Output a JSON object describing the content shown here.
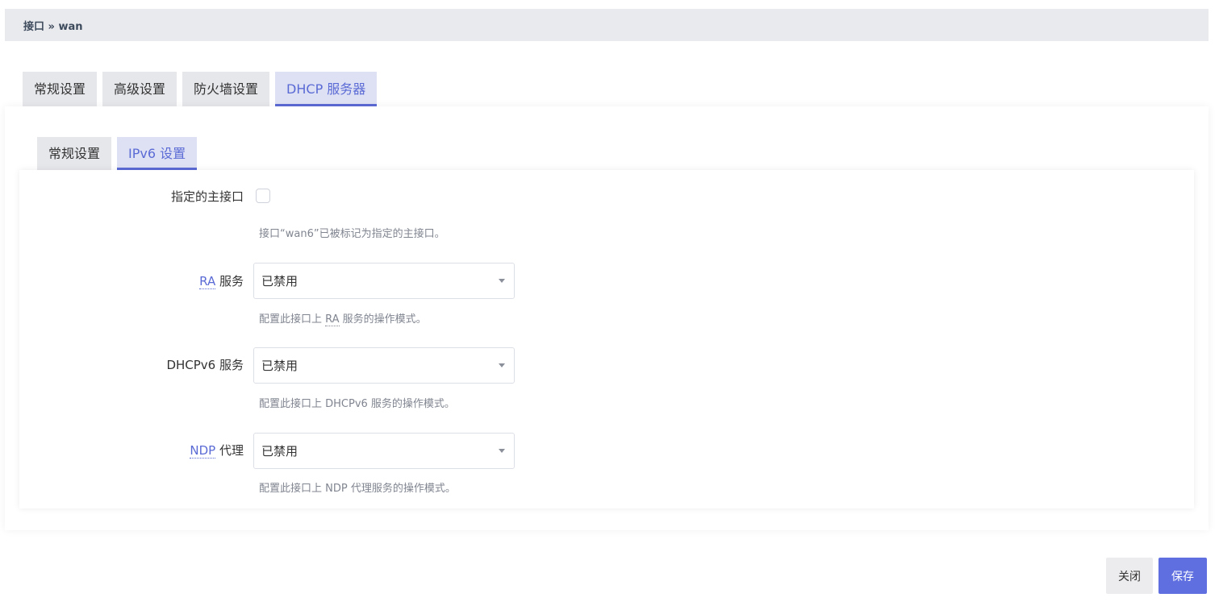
{
  "breadcrumb": {
    "text": "接口 » wan"
  },
  "top_tabs": [
    {
      "label": "常规设置"
    },
    {
      "label": "高级设置"
    },
    {
      "label": "防火墙设置"
    },
    {
      "label": "DHCP 服务器",
      "active": true
    }
  ],
  "sub_tabs": [
    {
      "label": "常规设置"
    },
    {
      "label": "IPv6 设置",
      "active": true
    }
  ],
  "form": {
    "master": {
      "label": "指定的主接口",
      "checked": false,
      "help": "接口“wan6”已被标记为指定的主接口。"
    },
    "ra": {
      "label_abbr": "RA",
      "label_rest": " 服务",
      "value": "已禁用",
      "help_pre": "配置此接口上 ",
      "help_abbr": "RA",
      "help_post": " 服务的操作模式。"
    },
    "dhcpv6": {
      "label": "DHCPv6 服务",
      "value": "已禁用",
      "help": "配置此接口上 DHCPv6 服务的操作模式。"
    },
    "ndp": {
      "label_abbr": "NDP",
      "label_rest": " 代理",
      "value": "已禁用",
      "help": "配置此接口上 NDP 代理服务的操作模式。"
    }
  },
  "buttons": {
    "close": "关闭",
    "save": "保存"
  },
  "colors": {
    "accent": "#5b6bd5",
    "save_button": "#5f6fe0"
  }
}
